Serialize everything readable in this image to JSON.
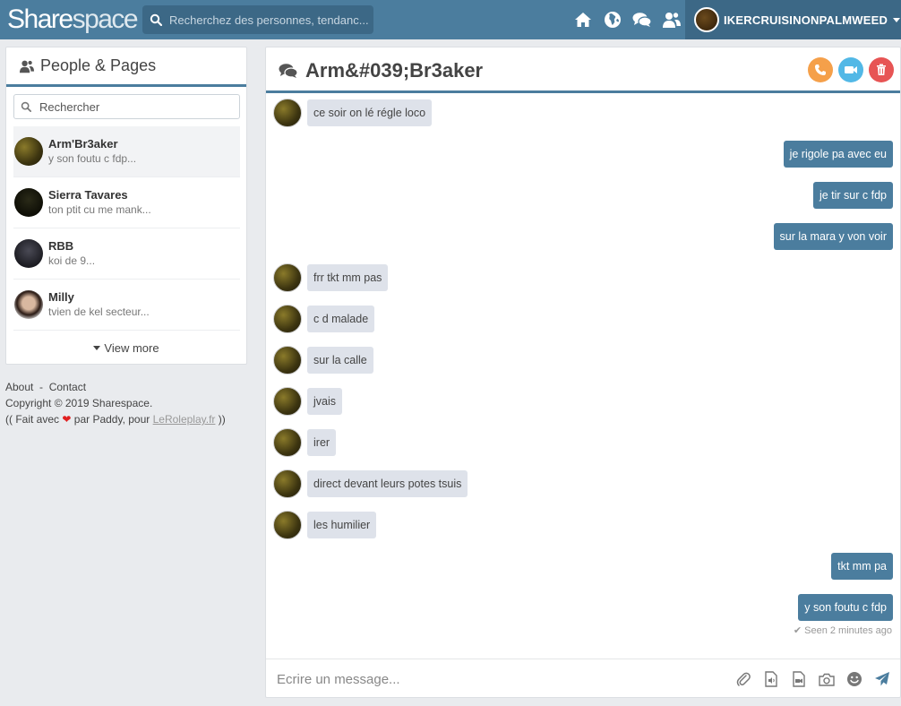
{
  "header": {
    "logo_part1": "Share",
    "logo_part2": "space",
    "search_placeholder": "Recherchez des personnes, tendanc...",
    "nav_icons": [
      "home-icon",
      "globe-icon",
      "chat-icon",
      "users-icon"
    ],
    "username": "IKERCRUISINONPALMWEED"
  },
  "sidebar": {
    "title": "People & Pages",
    "search_placeholder": "Rechercher",
    "contacts": [
      {
        "name": "Arm'Br3aker",
        "preview": "y son foutu c fdp..."
      },
      {
        "name": "Sierra Tavares",
        "preview": "ton ptit cu me mank..."
      },
      {
        "name": "RBB",
        "preview": "koi de 9..."
      },
      {
        "name": "Milly",
        "preview": "tvien de kel secteur..."
      }
    ],
    "view_more": "View more"
  },
  "footer": {
    "about": "About",
    "separator": "-",
    "contact": "Contact",
    "copyright": "Copyright © 2019 Sharespace.",
    "credit_prefix": "(( Fait avec",
    "credit_middle": "par Paddy, pour",
    "credit_link": "LeRoleplay.fr",
    "credit_suffix": "))"
  },
  "chat": {
    "title": "Arm&#039;Br3aker",
    "messages": [
      {
        "dir": "in",
        "text": "ce soir on lé régle loco"
      },
      {
        "dir": "out",
        "text": "je rigole pa avec eu"
      },
      {
        "dir": "out",
        "text": "je tir sur c fdp"
      },
      {
        "dir": "out",
        "text": "sur la mara y von voir"
      },
      {
        "dir": "in",
        "text": "frr tkt mm pas"
      },
      {
        "dir": "in",
        "text": "c d malade"
      },
      {
        "dir": "in",
        "text": "sur la calle"
      },
      {
        "dir": "in",
        "text": "jvais"
      },
      {
        "dir": "in",
        "text": "irer"
      },
      {
        "dir": "in",
        "text": "direct devant leurs potes tsuis"
      },
      {
        "dir": "in",
        "text": "les humilier"
      },
      {
        "dir": "out",
        "text": "tkt mm pa"
      },
      {
        "dir": "out",
        "text": "y son foutu c fdp"
      }
    ],
    "seen": "Seen 2 minutes ago",
    "composer_placeholder": "Ecrire un message...",
    "composer_tools": [
      "paperclip-icon",
      "audio-file-icon",
      "video-file-icon",
      "camera-icon",
      "smiley-icon",
      "send-icon"
    ]
  },
  "colors": {
    "brand": "#4b7d9e",
    "call_button": "#f5a04a",
    "video_button": "#52b8e6",
    "delete_button": "#e75454"
  }
}
